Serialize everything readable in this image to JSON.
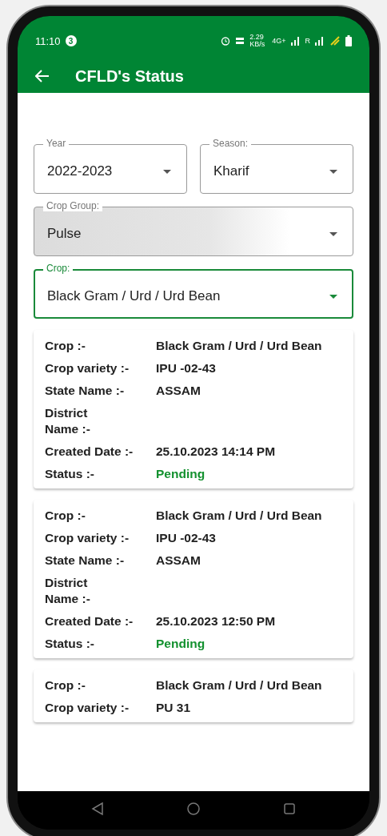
{
  "status_bar": {
    "time": "11:10",
    "notification_count": "3",
    "speed": "2.29 KB/s",
    "network": "4G+",
    "roaming": "R"
  },
  "app_bar": {
    "title": "CFLD's Status"
  },
  "filters": [
    {
      "label": "Year",
      "value": "2022-2023",
      "focused": false,
      "disabled": false,
      "half": true
    },
    {
      "label": "Season:",
      "value": "Kharif",
      "focused": false,
      "disabled": false,
      "half": true
    },
    {
      "label": "Crop Group:",
      "value": "Pulse",
      "focused": false,
      "disabled": true,
      "half": false
    },
    {
      "label": "Crop:",
      "value": "Black Gram / Urd / Urd Bean",
      "focused": true,
      "disabled": false,
      "half": false
    }
  ],
  "records": [
    {
      "rows": [
        {
          "label": "Crop :-",
          "value": "Black Gram / Urd / Urd Bean",
          "kind": "plain"
        },
        {
          "label": "Crop variety :-",
          "value": "IPU -02-43",
          "kind": "plain"
        },
        {
          "label": "State Name :-",
          "value": "ASSAM",
          "kind": "plain"
        },
        {
          "label": "District Name :-"
        },
        {
          "label": "Created Date :-",
          "value": "25.10.2023 14:14 PM",
          "kind": "plain"
        },
        {
          "label": "Status :-",
          "value": "Pending",
          "kind": "status"
        }
      ]
    },
    {
      "rows": [
        {
          "label": "Crop :-",
          "value": "Black Gram / Urd / Urd Bean",
          "kind": "plain"
        },
        {
          "label": "Crop variety :-",
          "value": "IPU -02-43",
          "kind": "plain"
        },
        {
          "label": "State Name :-",
          "value": "ASSAM",
          "kind": "plain"
        },
        {
          "label": "District Name :-"
        },
        {
          "label": "Created Date :-",
          "value": "25.10.2023 12:50 PM",
          "kind": "plain"
        },
        {
          "label": "Status :-",
          "value": "Pending",
          "kind": "status"
        }
      ]
    },
    {
      "rows": [
        {
          "label": "Crop :-",
          "value": "Black Gram / Urd / Urd Bean",
          "kind": "plain"
        },
        {
          "label": "Crop variety :-",
          "value": "PU 31",
          "kind": "plain"
        }
      ]
    }
  ]
}
